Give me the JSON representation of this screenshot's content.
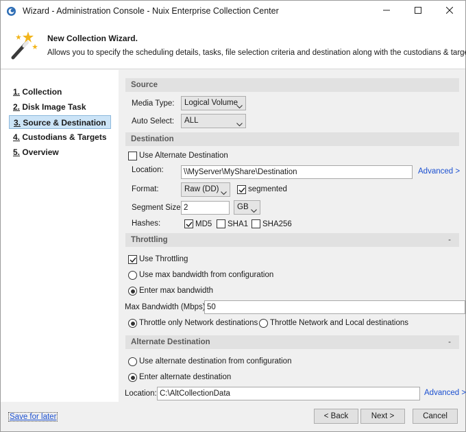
{
  "window": {
    "title": "Wizard - Administration Console - Nuix Enterprise Collection Center",
    "app_icon": "nuix-app-icon",
    "controls": [
      "minimize-icon",
      "maximize-icon",
      "close-icon"
    ]
  },
  "header": {
    "title": "New Collection Wizard.",
    "description": "Allows you to specify the scheduling details, tasks, file selection criteria and destination along with the custodians & targets.",
    "icon": "magic-wand-icon"
  },
  "steps": [
    {
      "num": "1.",
      "label": "Collection",
      "active": false
    },
    {
      "num": "2.",
      "label": "Disk Image Task",
      "active": false
    },
    {
      "num": "3.",
      "label": "Source & Destination",
      "active": true
    },
    {
      "num": "4.",
      "label": "Custodians & Targets",
      "active": false
    },
    {
      "num": "5.",
      "label": "Overview",
      "active": false
    }
  ],
  "source": {
    "heading": "Source",
    "media_type_label": "Media Type:",
    "media_type_value": "Logical Volume",
    "auto_select_label": "Auto Select:",
    "auto_select_value": "ALL"
  },
  "destination": {
    "heading": "Destination",
    "use_alternate_label": "Use Alternate Destination",
    "use_alternate_checked": false,
    "location_label": "Location:",
    "location_value": "\\\\MyServer\\MyShare\\Destination",
    "advanced_link": "Advanced >",
    "format_label": "Format:",
    "format_value": "Raw (DD)",
    "segmented_label": "segmented",
    "segmented_checked": true,
    "segment_size_label": "Segment Size:",
    "segment_size_value": "2",
    "segment_unit": "GB",
    "hashes_label": "Hashes:",
    "hashes": [
      {
        "label": "MD5",
        "checked": true
      },
      {
        "label": "SHA1",
        "checked": false
      },
      {
        "label": "SHA256",
        "checked": false
      }
    ]
  },
  "throttling": {
    "heading": "Throttling",
    "collapse": "-",
    "use_throttling_label": "Use Throttling",
    "use_throttling_checked": true,
    "bandwidth_options": [
      {
        "label": "Use max bandwidth from configuration",
        "selected": false
      },
      {
        "label": "Enter max bandwidth",
        "selected": true
      }
    ],
    "max_bandwidth_label": "Max Bandwidth (Mbps):",
    "max_bandwidth_value": "50",
    "throttle_options": [
      {
        "label": "Throttle only Network destinations",
        "selected": true
      },
      {
        "label": "Throttle Network and Local destinations",
        "selected": false
      }
    ]
  },
  "alternate_destination": {
    "heading": "Alternate Destination",
    "collapse": "-",
    "options": [
      {
        "label": "Use alternate destination from configuration",
        "selected": false
      },
      {
        "label": "Enter alternate destination",
        "selected": true
      }
    ],
    "location_label": "Location:",
    "location_value": "C:\\AltCollectionData",
    "advanced_link": "Advanced >"
  },
  "footer": {
    "save_later": "Save for later",
    "back": "< Back",
    "next": "Next >",
    "cancel": "Cancel"
  }
}
